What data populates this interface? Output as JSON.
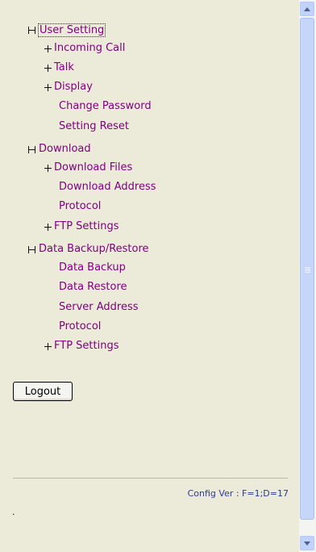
{
  "menu": {
    "user_setting": {
      "label": "User Setting",
      "incoming_call": "Incoming Call",
      "talk": "Talk",
      "display": "Display",
      "change_password": "Change Password",
      "setting_reset": "Setting Reset"
    },
    "download": {
      "label": "Download",
      "download_files": "Download Files",
      "download_address": "Download Address",
      "protocol": "Protocol",
      "ftp_settings": "FTP Settings"
    },
    "data_backup": {
      "label": "Data Backup/Restore",
      "data_backup": "Data Backup",
      "data_restore": "Data Restore",
      "server_address": "Server Address",
      "protocol": "Protocol",
      "ftp_settings": "FTP Settings"
    }
  },
  "logout_label": "Logout",
  "config_version": "Config Ver : F=1;D=17",
  "footer_dot": ".",
  "colors": {
    "background": "#ecead8",
    "link": "#800080",
    "version_text": "#2d3a96",
    "scrollbar": "#c6d6fb"
  },
  "icons": {
    "expand": "plus-box-icon",
    "collapse": "minus-box-icon"
  }
}
